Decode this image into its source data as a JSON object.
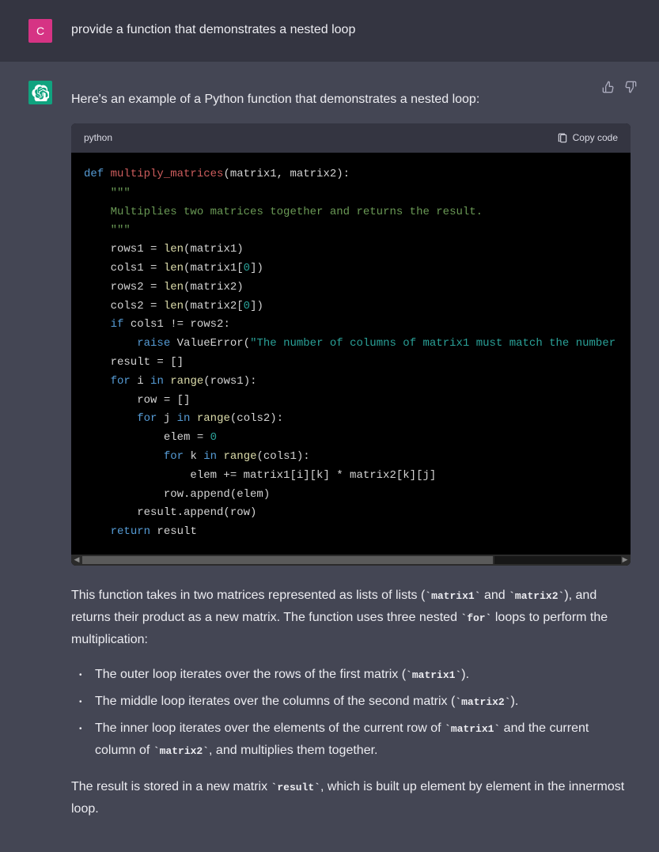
{
  "user": {
    "avatar_letter": "C",
    "prompt": "provide a function that demonstrates a nested loop"
  },
  "assistant": {
    "intro": "Here's an example of a Python function that demonstrates a nested loop:",
    "code_lang": "python",
    "copy_label": "Copy code",
    "code_tokens": [
      [
        [
          "kw",
          "def "
        ],
        [
          "fn-def",
          "multiply_matrices"
        ],
        [
          "op",
          "(matrix1, matrix2):"
        ]
      ],
      [
        [
          "op",
          "    "
        ],
        [
          "str",
          "\"\"\""
        ]
      ],
      [
        [
          "op",
          "    "
        ],
        [
          "str",
          "Multiplies two matrices together and returns the result."
        ]
      ],
      [
        [
          "op",
          "    "
        ],
        [
          "str",
          "\"\"\""
        ]
      ],
      [
        [
          "op",
          "    rows1 = "
        ],
        [
          "fn",
          "len"
        ],
        [
          "op",
          "(matrix1)"
        ]
      ],
      [
        [
          "op",
          "    cols1 = "
        ],
        [
          "fn",
          "len"
        ],
        [
          "op",
          "(matrix1["
        ],
        [
          "numzero",
          "0"
        ],
        [
          "op",
          "])"
        ]
      ],
      [
        [
          "op",
          "    rows2 = "
        ],
        [
          "fn",
          "len"
        ],
        [
          "op",
          "(matrix2)"
        ]
      ],
      [
        [
          "op",
          "    cols2 = "
        ],
        [
          "fn",
          "len"
        ],
        [
          "op",
          "(matrix2["
        ],
        [
          "numzero",
          "0"
        ],
        [
          "op",
          "])"
        ]
      ],
      [
        [
          "op",
          "    "
        ],
        [
          "kw",
          "if"
        ],
        [
          "op",
          " cols1 != rows2:"
        ]
      ],
      [
        [
          "op",
          "        "
        ],
        [
          "kw",
          "raise"
        ],
        [
          "op",
          " ValueError("
        ],
        [
          "strlit",
          "\"The number of columns of matrix1 must match the number"
        ]
      ],
      [
        [
          "op",
          "    result = []"
        ]
      ],
      [
        [
          "op",
          "    "
        ],
        [
          "kw",
          "for"
        ],
        [
          "op",
          " i "
        ],
        [
          "kw",
          "in"
        ],
        [
          "op",
          " "
        ],
        [
          "fn",
          "range"
        ],
        [
          "op",
          "(rows1):"
        ]
      ],
      [
        [
          "op",
          "        row = []"
        ]
      ],
      [
        [
          "op",
          "        "
        ],
        [
          "kw",
          "for"
        ],
        [
          "op",
          " j "
        ],
        [
          "kw",
          "in"
        ],
        [
          "op",
          " "
        ],
        [
          "fn",
          "range"
        ],
        [
          "op",
          "(cols2):"
        ]
      ],
      [
        [
          "op",
          "            elem = "
        ],
        [
          "numzero",
          "0"
        ]
      ],
      [
        [
          "op",
          "            "
        ],
        [
          "kw",
          "for"
        ],
        [
          "op",
          " k "
        ],
        [
          "kw",
          "in"
        ],
        [
          "op",
          " "
        ],
        [
          "fn",
          "range"
        ],
        [
          "op",
          "(cols1):"
        ]
      ],
      [
        [
          "op",
          "                elem += matrix1[i][k] * matrix2[k][j]"
        ]
      ],
      [
        [
          "op",
          "            row.append(elem)"
        ]
      ],
      [
        [
          "op",
          "        result.append(row)"
        ]
      ],
      [
        [
          "op",
          "    "
        ],
        [
          "kw",
          "return"
        ],
        [
          "op",
          " result"
        ]
      ]
    ],
    "para1": {
      "t1": "This function takes in two matrices represented as lists of lists (",
      "c1": "`matrix1`",
      "t2": " and ",
      "c2": "`matrix2`",
      "t3": "), and returns their product as a new matrix. The function uses three nested ",
      "c3": "`for`",
      "t4": " loops to perform the multiplication:"
    },
    "bullets": [
      {
        "t1": "The outer loop iterates over the rows of the first matrix (",
        "c1": "`matrix1`",
        "t2": ")."
      },
      {
        "t1": "The middle loop iterates over the columns of the second matrix (",
        "c1": "`matrix2`",
        "t2": ")."
      },
      {
        "t1": "The inner loop iterates over the elements of the current row of ",
        "c1": "`matrix1`",
        "t2": " and the current column of ",
        "c2": "`matrix2`",
        "t3": ", and multiplies them together."
      }
    ],
    "para2": {
      "t1": "The result is stored in a new matrix ",
      "c1": "`result`",
      "t2": ", which is built up element by element in the innermost loop."
    }
  }
}
